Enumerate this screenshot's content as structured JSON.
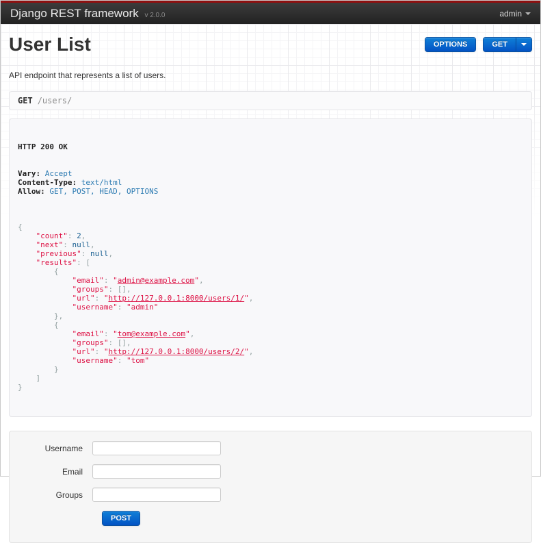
{
  "navbar": {
    "brand": "Django REST framework",
    "version": "v 2.0.0",
    "user_menu": "admin"
  },
  "page": {
    "title": "User List",
    "description": "API endpoint that represents a list of users."
  },
  "toolbar": {
    "options_label": "OPTIONS",
    "get_label": "GET"
  },
  "request": {
    "method": "GET",
    "path": "/users/"
  },
  "response": {
    "status_line": "HTTP 200 OK",
    "headers": [
      {
        "name": "Vary:",
        "value": "Accept"
      },
      {
        "name": "Content-Type:",
        "value": "text/html"
      },
      {
        "name": "Allow:",
        "value": "GET, POST, HEAD, OPTIONS"
      }
    ],
    "body_lines": [
      [
        [
          "pun",
          "{"
        ]
      ],
      [
        [
          "pln",
          "    "
        ],
        [
          "key",
          "\"count\""
        ],
        [
          "pun",
          ": "
        ],
        [
          "lit",
          "2"
        ],
        [
          "pun",
          ","
        ]
      ],
      [
        [
          "pln",
          "    "
        ],
        [
          "key",
          "\"next\""
        ],
        [
          "pun",
          ": "
        ],
        [
          "lit",
          "null"
        ],
        [
          "pun",
          ","
        ]
      ],
      [
        [
          "pln",
          "    "
        ],
        [
          "key",
          "\"previous\""
        ],
        [
          "pun",
          ": "
        ],
        [
          "lit",
          "null"
        ],
        [
          "pun",
          ","
        ]
      ],
      [
        [
          "pln",
          "    "
        ],
        [
          "key",
          "\"results\""
        ],
        [
          "pun",
          ": ["
        ]
      ],
      [
        [
          "pln",
          "        "
        ],
        [
          "pun",
          "{"
        ]
      ],
      [
        [
          "pln",
          "            "
        ],
        [
          "key",
          "\"email\""
        ],
        [
          "pun",
          ": "
        ],
        [
          "str",
          "\""
        ],
        [
          "link",
          "admin@example.com"
        ],
        [
          "str",
          "\""
        ],
        [
          "pun",
          ","
        ]
      ],
      [
        [
          "pln",
          "            "
        ],
        [
          "key",
          "\"groups\""
        ],
        [
          "pun",
          ": [],"
        ]
      ],
      [
        [
          "pln",
          "            "
        ],
        [
          "key",
          "\"url\""
        ],
        [
          "pun",
          ": "
        ],
        [
          "str",
          "\""
        ],
        [
          "link",
          "http://127.0.0.1:8000/users/1/"
        ],
        [
          "str",
          "\""
        ],
        [
          "pun",
          ","
        ]
      ],
      [
        [
          "pln",
          "            "
        ],
        [
          "key",
          "\"username\""
        ],
        [
          "pun",
          ": "
        ],
        [
          "str",
          "\"admin\""
        ]
      ],
      [
        [
          "pln",
          "        "
        ],
        [
          "pun",
          "},"
        ]
      ],
      [
        [
          "pln",
          "        "
        ],
        [
          "pun",
          "{"
        ]
      ],
      [
        [
          "pln",
          "            "
        ],
        [
          "key",
          "\"email\""
        ],
        [
          "pun",
          ": "
        ],
        [
          "str",
          "\""
        ],
        [
          "link",
          "tom@example.com"
        ],
        [
          "str",
          "\""
        ],
        [
          "pun",
          ","
        ]
      ],
      [
        [
          "pln",
          "            "
        ],
        [
          "key",
          "\"groups\""
        ],
        [
          "pun",
          ": [],"
        ]
      ],
      [
        [
          "pln",
          "            "
        ],
        [
          "key",
          "\"url\""
        ],
        [
          "pun",
          ": "
        ],
        [
          "str",
          "\""
        ],
        [
          "link",
          "http://127.0.0.1:8000/users/2/"
        ],
        [
          "str",
          "\""
        ],
        [
          "pun",
          ","
        ]
      ],
      [
        [
          "pln",
          "            "
        ],
        [
          "key",
          "\"username\""
        ],
        [
          "pun",
          ": "
        ],
        [
          "str",
          "\"tom\""
        ]
      ],
      [
        [
          "pln",
          "        "
        ],
        [
          "pun",
          "}"
        ]
      ],
      [
        [
          "pln",
          "    "
        ],
        [
          "pun",
          "]"
        ]
      ],
      [
        [
          "pun",
          "}"
        ]
      ]
    ]
  },
  "form": {
    "fields": [
      {
        "name": "username",
        "label": "Username",
        "value": "",
        "placeholder": ""
      },
      {
        "name": "email",
        "label": "Email",
        "value": "",
        "placeholder": ""
      },
      {
        "name": "groups",
        "label": "Groups",
        "value": "",
        "placeholder": ""
      }
    ],
    "submit_label": "POST"
  },
  "colors": {
    "accent_red": "#8f1010",
    "navbar_bg": "#2b2b2b",
    "button_blue_top": "#1080d8",
    "button_blue_bottom": "#0353c4",
    "code_string": "#dd1144",
    "code_literal": "#195f91",
    "code_punctuation": "#93a1a1",
    "header_value_blue": "#2d7bb2"
  }
}
